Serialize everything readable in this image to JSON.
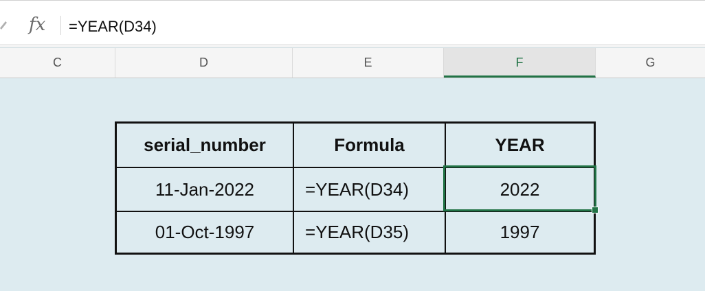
{
  "formula_bar": {
    "fx_label": "fx",
    "formula": "=YEAR(D34)"
  },
  "columns": [
    {
      "label": "C"
    },
    {
      "label": "D"
    },
    {
      "label": "E"
    },
    {
      "label": "F",
      "selected": true
    },
    {
      "label": "G"
    }
  ],
  "table": {
    "headers": [
      "serial_number",
      "Formula",
      "YEAR"
    ],
    "rows": [
      {
        "serial_number": "11-Jan-2022",
        "formula": "=YEAR(D34)",
        "year": "2022"
      },
      {
        "serial_number": "01-Oct-1997",
        "formula": "=YEAR(D35)",
        "year": "1997"
      }
    ]
  },
  "colors": {
    "background": "#ddebf0",
    "accent": "#217346",
    "border": "#111111"
  }
}
